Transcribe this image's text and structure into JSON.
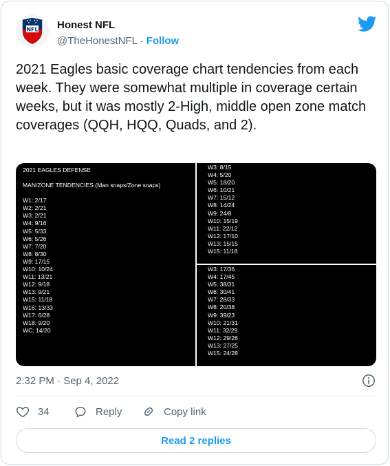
{
  "author": {
    "name": "Honest NFL",
    "handle": "@TheHonestNFL",
    "separator": "·",
    "follow_label": "Follow"
  },
  "tweet": {
    "text": "2021 Eagles basic coverage chart tendencies from each week. They were somewhat multiple in coverage certain weeks, but it was mostly 2-High, middle open zone match coverages (QQH, HQQ, Quads, and 2).",
    "timestamp": "2:32 PM · Sep 4, 2022"
  },
  "image": {
    "left_title": "2021 EAGLES DEFENSE",
    "left_subtitle": "MAN/ZONE TENDENCIES  (Man snaps/Zone snaps)",
    "left_rows": [
      "W1: 2/17",
      "W2: 2/21",
      "W3: 2/21",
      "W4: 9/16",
      "W5: 5/33",
      "W6: 5/26",
      "W7: 7/20",
      "W8: 8/30",
      "W9: 17/15",
      "W10: 10/24",
      "W11: 13/21",
      "W12: 9/18",
      "W13: 9/21",
      "W15: 11/18",
      "W16: 13/33",
      "W17: 6/28",
      "W18: 9/20",
      "WC: 14/20"
    ],
    "right_top_rows": [
      "W3: 8/15",
      "W4: 5/20",
      "W5: 18/20",
      "W6: 10/21",
      "W7: 15/12",
      "W8: 14/24",
      "W9: 24/8",
      "W10: 15/19",
      "W11: 22/12",
      "W12: 17/10",
      "W13: 15/15",
      "W15: 11/18"
    ],
    "right_bottom_rows": [
      "W3: 17/36",
      "W4: 17/45",
      "W5: 38/31",
      "W6: 30/41",
      "W7: 28/33",
      "W8: 20/38",
      "W9: 39/23",
      "W10: 21/31",
      "W11: 32/29",
      "W12: 29/26",
      "W13: 27/25",
      "W15: 24/28"
    ]
  },
  "actions": {
    "like_count": "34",
    "reply_label": "Reply",
    "copy_link_label": "Copy link",
    "read_replies_label": "Read 2 replies"
  },
  "colors": {
    "accent": "#1d9bf0",
    "muted_text": "#536471",
    "border": "#cfd9de",
    "panel_bg": "#000000"
  }
}
